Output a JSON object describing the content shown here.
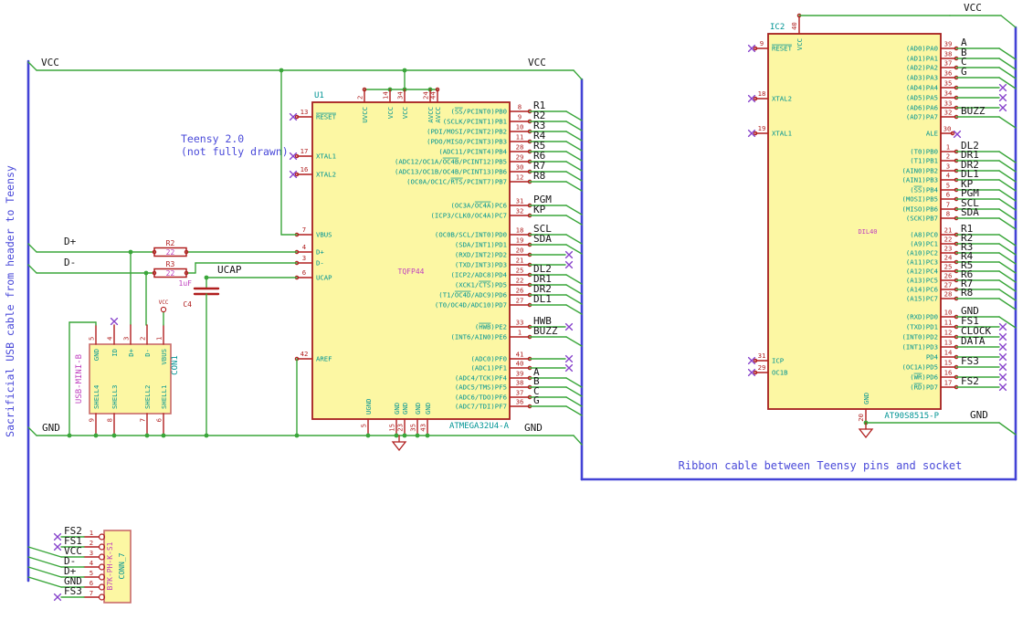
{
  "notes": {
    "sacrificial": "Sacrificial USB cable from header to Teensy",
    "teensy_line1": "Teensy 2.0",
    "teensy_line2": "(not fully drawn)",
    "ribbon": "Ribbon cable between Teensy pins and socket"
  },
  "nets": {
    "vcc": "VCC",
    "gnd": "GND",
    "dplus": "D+",
    "dminus": "D-",
    "ucap": "UCAP"
  },
  "colors": {
    "wire": "#3aa63a",
    "bus": "#4343d6",
    "pin": "#b01e1e",
    "body_border": "#a61e1e",
    "body_fill": "#fcf7a3",
    "pin_name": "#009494",
    "reference": "#009494",
    "value": "#bf40bf",
    "net_label": "#151515",
    "no_connect": "#8844cc",
    "note": "#4a4ad9"
  },
  "u1": {
    "ref": "U1",
    "value": "TQFP44",
    "part": "ATMEGA32U4-A",
    "left_pins": [
      {
        "n": "13",
        "name": "`RESET`",
        "term": "nc"
      },
      {
        "n": "17",
        "name": "XTAL1",
        "term": "nc"
      },
      {
        "n": "16",
        "name": "XTAL2",
        "term": "nc"
      },
      {
        "n": "7",
        "name": "VBUS",
        "term": "wire"
      },
      {
        "n": "4",
        "name": "D+",
        "term": "wire"
      },
      {
        "n": "3",
        "name": "D-",
        "term": "wire"
      },
      {
        "n": "6",
        "name": "UCAP",
        "term": "wire"
      },
      {
        "n": "42",
        "name": "AREF",
        "term": "wire"
      }
    ],
    "top_pins": [
      {
        "n": "2",
        "name": "UVCC"
      },
      {
        "n": "14",
        "name": "VCC"
      },
      {
        "n": "34",
        "name": "VCC"
      },
      {
        "n": "24",
        "name": "AVCC"
      },
      {
        "n": "44",
        "name": "AVCC"
      }
    ],
    "bottom_pins": [
      {
        "n": "5",
        "name": "UGND"
      },
      {
        "n": "15",
        "name": "GND"
      },
      {
        "n": "23",
        "name": "GND"
      },
      {
        "n": "35",
        "name": "GND"
      },
      {
        "n": "43",
        "name": "GND"
      }
    ],
    "right_pins": [
      {
        "n": "8",
        "name": "(`SS`/PCINT0)PB0",
        "net": "R1",
        "term": "bus"
      },
      {
        "n": "9",
        "name": "(SCLK/PCINT1)PB1",
        "net": "R2",
        "term": "bus"
      },
      {
        "n": "10",
        "name": "(PDI/MOSI/PCINT2)PB2",
        "net": "R3",
        "term": "bus"
      },
      {
        "n": "11",
        "name": "(PDO/MISO/PCINT3)PB3",
        "net": "R4",
        "term": "bus"
      },
      {
        "n": "28",
        "name": "(ADC11/PCINT4)PB4",
        "net": "R5",
        "term": "bus"
      },
      {
        "n": "29",
        "name": "(ADC12/OC1A/`OC4B`/PCINT12)PB5",
        "net": "R6",
        "term": "bus"
      },
      {
        "n": "30",
        "name": "(ADC13/OC1B/OC4B/PCINT13)PB6",
        "net": "R7",
        "term": "bus"
      },
      {
        "n": "12",
        "name": "(OC0A/OC1C/`RTS`/PCINT7)PB7",
        "net": "R8",
        "term": "bus"
      },
      {
        "n": "31",
        "name": "(OC3A/`OC4A`)PC6",
        "net": "PGM",
        "term": "bus"
      },
      {
        "n": "32",
        "name": "(ICP3/CLK0/OC4A)PC7",
        "net": "KP",
        "term": "bus"
      },
      {
        "n": "18",
        "name": "(OC0B/SCL/INT0)PD0",
        "net": "SCL",
        "term": "bus"
      },
      {
        "n": "19",
        "name": "(SDA/INT1)PD1",
        "net": "SDA",
        "term": "bus"
      },
      {
        "n": "20",
        "name": "(RXD/INT2)PD2",
        "net": "",
        "term": "nc"
      },
      {
        "n": "21",
        "name": "(TXD/INT3)PD3",
        "net": "",
        "term": "nc"
      },
      {
        "n": "25",
        "name": "(ICP2/ADC8)PD4",
        "net": "DL2",
        "term": "bus"
      },
      {
        "n": "22",
        "name": "(XCK1/`CTS`)PD5",
        "net": "DR1",
        "term": "bus"
      },
      {
        "n": "26",
        "name": "(T1/`OC4D`/ADC9)PD6",
        "net": "DR2",
        "term": "bus"
      },
      {
        "n": "27",
        "name": "(T0/OC4D/ADC10)PD7",
        "net": "DL1",
        "term": "bus"
      },
      {
        "n": "33",
        "name": "(`HWB`)PE2",
        "net": "HWB",
        "term": "nc"
      },
      {
        "n": "1",
        "name": "(INT6/AIN0)PE6",
        "net": "BUZZ",
        "term": "bus"
      },
      {
        "n": "41",
        "name": "(ADC0)PF0",
        "net": "",
        "term": "nc"
      },
      {
        "n": "40",
        "name": "(ADC1)PF1",
        "net": "",
        "term": "nc"
      },
      {
        "n": "39",
        "name": "(ADC4/TCK)PF4",
        "net": "A",
        "term": "bus"
      },
      {
        "n": "38",
        "name": "(ADC5/TMS)PF5",
        "net": "B",
        "term": "bus"
      },
      {
        "n": "37",
        "name": "(ADC6/TDO)PF6",
        "net": "C",
        "term": "bus"
      },
      {
        "n": "36",
        "name": "(ADC7/TDI)PF7",
        "net": "G",
        "term": "bus"
      }
    ]
  },
  "ic2": {
    "ref": "IC2",
    "value": "DIL40",
    "part": "AT90S8515-P",
    "left_pins": [
      {
        "n": "9",
        "name": "`RESET`",
        "term": "nc"
      },
      {
        "n": "18",
        "name": "XTAL2",
        "term": "nc"
      },
      {
        "n": "19",
        "name": "XTAL1",
        "term": "nc"
      },
      {
        "n": "31",
        "name": "ICP",
        "term": "nc"
      },
      {
        "n": "29",
        "name": "OC1B",
        "term": "nc"
      }
    ],
    "top_pins": [
      {
        "n": "40",
        "name": "VCC"
      }
    ],
    "bottom_pins": [
      {
        "n": "20",
        "name": "GND"
      }
    ],
    "right_pins": [
      {
        "n": "39",
        "name": "(AD0)PA0",
        "net": "A",
        "term": "bus"
      },
      {
        "n": "38",
        "name": "(AD1)PA1",
        "net": "B",
        "term": "bus"
      },
      {
        "n": "37",
        "name": "(AD2)PA2",
        "net": "C",
        "term": "bus"
      },
      {
        "n": "36",
        "name": "(AD3)PA3",
        "net": "G",
        "term": "bus"
      },
      {
        "n": "35",
        "name": "(AD4)PA4",
        "net": "",
        "term": "nc"
      },
      {
        "n": "34",
        "name": "(AD5)PA5",
        "net": "",
        "term": "nc"
      },
      {
        "n": "33",
        "name": "(AD6)PA6",
        "net": "",
        "term": "nc"
      },
      {
        "n": "32",
        "name": "(AD7)PA7",
        "net": "BUZZ",
        "term": "bus"
      },
      {
        "n": "30",
        "name": "ALE",
        "net": "",
        "term": "ncshort"
      },
      {
        "n": "1",
        "name": "(T0)PB0",
        "net": "DL2",
        "term": "bus"
      },
      {
        "n": "2",
        "name": "(T1)PB1",
        "net": "DR1",
        "term": "bus"
      },
      {
        "n": "3",
        "name": "(AIN0)PB2",
        "net": "DR2",
        "term": "bus"
      },
      {
        "n": "4",
        "name": "(AIN1)PB3",
        "net": "DL1",
        "term": "bus"
      },
      {
        "n": "5",
        "name": "(`SS`)PB4",
        "net": "KP",
        "term": "bus"
      },
      {
        "n": "6",
        "name": "(MOSI)PB5",
        "net": "PGM",
        "term": "bus"
      },
      {
        "n": "7",
        "name": "(MISO)PB6",
        "net": "SCL",
        "term": "bus"
      },
      {
        "n": "8",
        "name": "(SCK)PB7",
        "net": "SDA",
        "term": "bus"
      },
      {
        "n": "21",
        "name": "(A8)PC0",
        "net": "R1",
        "term": "bus"
      },
      {
        "n": "22",
        "name": "(A9)PC1",
        "net": "R2",
        "term": "bus"
      },
      {
        "n": "23",
        "name": "(A10)PC2",
        "net": "R3",
        "term": "bus"
      },
      {
        "n": "24",
        "name": "(A11)PC3",
        "net": "R4",
        "term": "bus"
      },
      {
        "n": "25",
        "name": "(A12)PC4",
        "net": "R5",
        "term": "bus"
      },
      {
        "n": "26",
        "name": "(A13)PC5",
        "net": "R6",
        "term": "bus"
      },
      {
        "n": "27",
        "name": "(A14)PC6",
        "net": "R7",
        "term": "bus"
      },
      {
        "n": "28",
        "name": "(A15)PC7",
        "net": "R8",
        "term": "bus"
      },
      {
        "n": "10",
        "name": "(RXD)PD0",
        "net": "GND",
        "term": "bus"
      },
      {
        "n": "11",
        "name": "(TXD)PD1",
        "net": "FS1",
        "term": "nc"
      },
      {
        "n": "12",
        "name": "(INT0)PD2",
        "net": "CLOCK",
        "term": "nc"
      },
      {
        "n": "13",
        "name": "(INT1)PD3",
        "net": "DATA",
        "term": "nc"
      },
      {
        "n": "14",
        "name": "PD4",
        "net": "",
        "term": "nc"
      },
      {
        "n": "15",
        "name": "(OC1A)PD5",
        "net": "FS3",
        "term": "nc"
      },
      {
        "n": "16",
        "name": "(`WR`)PD6",
        "net": "",
        "term": "nc"
      },
      {
        "n": "17",
        "name": "(`RD`)PD7",
        "net": "FS2",
        "term": "nc"
      }
    ]
  },
  "con1": {
    "ref": "CON1",
    "value": "USB-MINI-B",
    "top_pins": [
      {
        "n": "5",
        "name": "GND"
      },
      {
        "n": "4",
        "name": "ID"
      },
      {
        "n": "3",
        "name": "D+"
      },
      {
        "n": "2",
        "name": "D-"
      },
      {
        "n": "1",
        "name": "VBUS"
      }
    ],
    "bottom_pins": [
      {
        "n": "9",
        "name": "SHELL4"
      },
      {
        "n": "8",
        "name": "SHELL3"
      },
      {
        "n": "7",
        "name": "SHELL2"
      },
      {
        "n": "6",
        "name": "SHELL1"
      }
    ]
  },
  "conn7": {
    "ref": "CONN_7",
    "value": "B7K-PH-K-S1",
    "pins": [
      {
        "n": "1",
        "net": "FS2",
        "term": "nc"
      },
      {
        "n": "2",
        "net": "FS1",
        "term": "nc"
      },
      {
        "n": "3",
        "net": "VCC",
        "term": "bus"
      },
      {
        "n": "4",
        "net": "D-",
        "term": "bus"
      },
      {
        "n": "5",
        "net": "D+",
        "term": "bus"
      },
      {
        "n": "6",
        "net": "GND",
        "term": "bus"
      },
      {
        "n": "7",
        "net": "FS3",
        "term": "nc"
      }
    ]
  },
  "r2": {
    "ref": "R2",
    "value": "22"
  },
  "r3": {
    "ref": "R3",
    "value": "22"
  },
  "c4": {
    "ref": "C4",
    "value": "1uF"
  },
  "vcc_flag": "VCC"
}
